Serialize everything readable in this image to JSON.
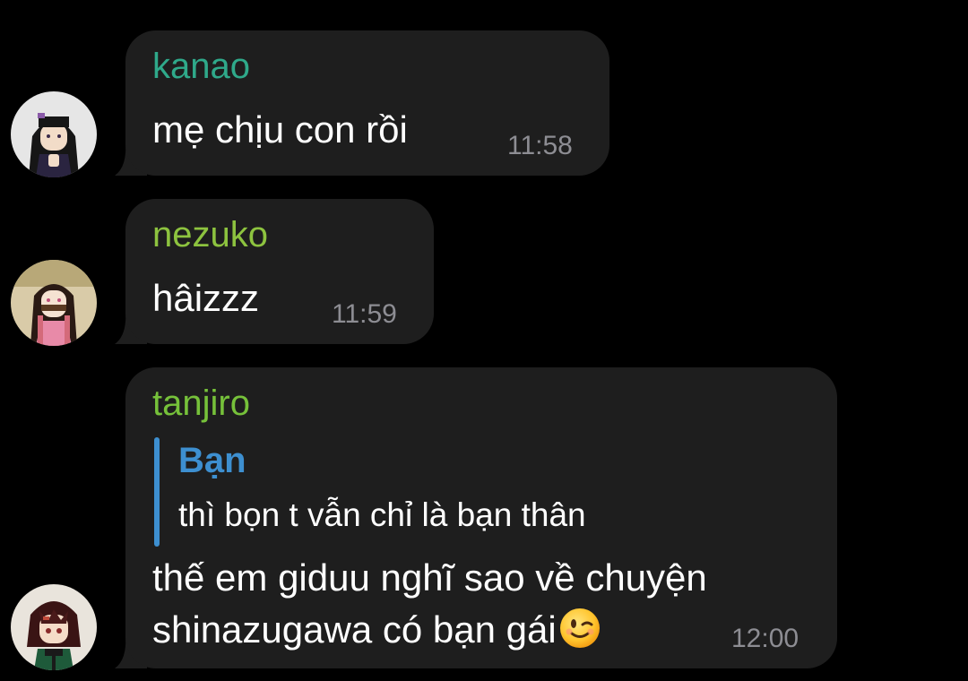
{
  "messages": [
    {
      "sender": "kanao",
      "sender_color": "#2fa98a",
      "text": "mẹ chịu con rồi",
      "time": "11:58",
      "avatar_icon": "kanao-avatar-icon"
    },
    {
      "sender": "nezuko",
      "sender_color": "#8dc33f",
      "text": "hâizzz",
      "time": "11:59",
      "avatar_icon": "nezuko-avatar-icon"
    },
    {
      "sender": "tanjiro",
      "sender_color": "#76c13a",
      "reply": {
        "author": "Bạn",
        "author_color": "#3d8fd0",
        "text": "thì bọn t vẫn chỉ là bạn thân"
      },
      "text_lines": [
        "thế em giduu nghĩ sao về chuyện",
        "shinazugawa có bạn gái"
      ],
      "emoji": "winking-face-emoji",
      "time": "12:00",
      "avatar_icon": "tanjiro-avatar-icon"
    }
  ],
  "colors": {
    "background": "#000000",
    "bubble": "#1e1e1e",
    "timestamp": "#8d8d93",
    "message_text": "#ffffff"
  }
}
